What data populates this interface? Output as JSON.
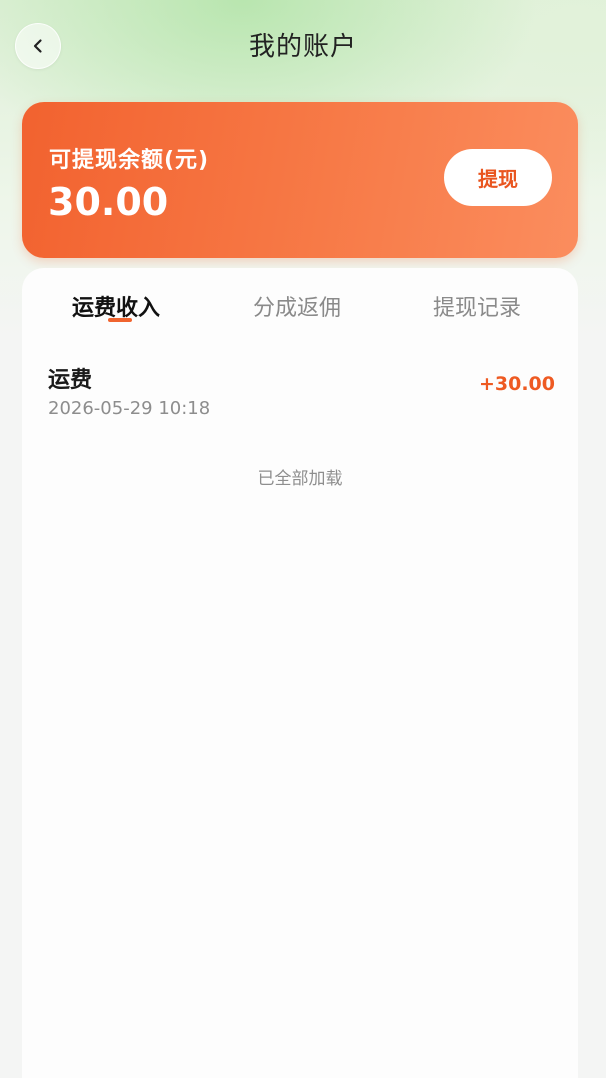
{
  "header": {
    "title": "我的账户",
    "back_icon": "chevron-left-icon"
  },
  "balance": {
    "label": "可提现余额(元)",
    "value": "30.00",
    "withdraw_label": "提现"
  },
  "tabs": [
    {
      "label": "运费收入",
      "active": true
    },
    {
      "label": "分成返佣",
      "active": false
    },
    {
      "label": "提现记录",
      "active": false
    }
  ],
  "records": [
    {
      "title": "运费",
      "time": "2026-05-29 10:18",
      "amount": "+30.00"
    }
  ],
  "footer_text": "已全部加载",
  "colors": {
    "accent": "#f0642f",
    "amount": "#ee5a22"
  }
}
